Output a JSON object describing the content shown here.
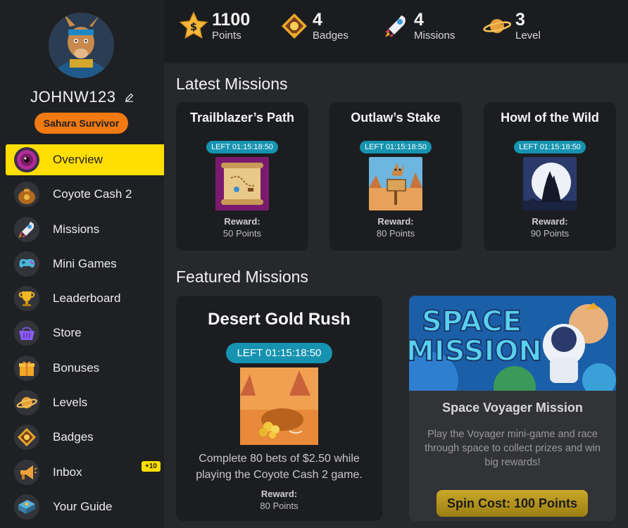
{
  "profile": {
    "username": "JOHNW123",
    "rank": "Sahara Survivor"
  },
  "nav": {
    "items": [
      {
        "label": "Overview",
        "icon": "eye-icon"
      },
      {
        "label": "Coyote Cash 2",
        "icon": "money-bag-icon"
      },
      {
        "label": "Missions",
        "icon": "rocket-icon"
      },
      {
        "label": "Mini Games",
        "icon": "gamepad-icon"
      },
      {
        "label": "Leaderboard",
        "icon": "trophy-icon"
      },
      {
        "label": "Store",
        "icon": "basket-icon"
      },
      {
        "label": "Bonuses",
        "icon": "gift-icon"
      },
      {
        "label": "Levels",
        "icon": "planet-icon"
      },
      {
        "label": "Badges",
        "icon": "badge-icon"
      },
      {
        "label": "Inbox",
        "icon": "megaphone-icon",
        "badge": "+10"
      },
      {
        "label": "Your Guide",
        "icon": "book-icon"
      }
    ]
  },
  "stats": {
    "points": {
      "value": "1100",
      "label": "Points"
    },
    "badges": {
      "value": "4",
      "label": "Badges"
    },
    "missions": {
      "value": "4",
      "label": "Missions"
    },
    "level": {
      "value": "3",
      "label": "Level"
    }
  },
  "latest": {
    "title": "Latest Missions",
    "cards": [
      {
        "title": "Trailblazer’s Path",
        "timer": "LEFT 01:15:18:50",
        "reward_label": "Reward:",
        "reward": "50 Points"
      },
      {
        "title": "Outlaw’s Stake",
        "timer": "LEFT 01:15:18:50",
        "reward_label": "Reward:",
        "reward": "80 Points"
      },
      {
        "title": "Howl of the Wild",
        "timer": "LEFT 01:15:18:50",
        "reward_label": "Reward:",
        "reward": "90 Points"
      }
    ]
  },
  "featured": {
    "title": "Featured Missions",
    "main": {
      "title": "Desert Gold Rush",
      "timer": "LEFT 01:15:18:50",
      "description": "Complete 80 bets of $2.50 while playing the Coyote Cash 2 game.",
      "reward_label": "Reward:",
      "reward": "80 Points"
    },
    "space": {
      "banner_line1": "SPACE",
      "banner_line2": "MISSION",
      "title": "Space Voyager Mission",
      "description": "Play the Voyager mini-game and race through space to collect prizes and win big rewards!",
      "button": "Spin Cost: 100 Points"
    }
  },
  "colors": {
    "accent": "#ffde00",
    "rank_badge": "#f27a13",
    "timer": "#1593b0",
    "spin_button": "#c9a82a"
  }
}
